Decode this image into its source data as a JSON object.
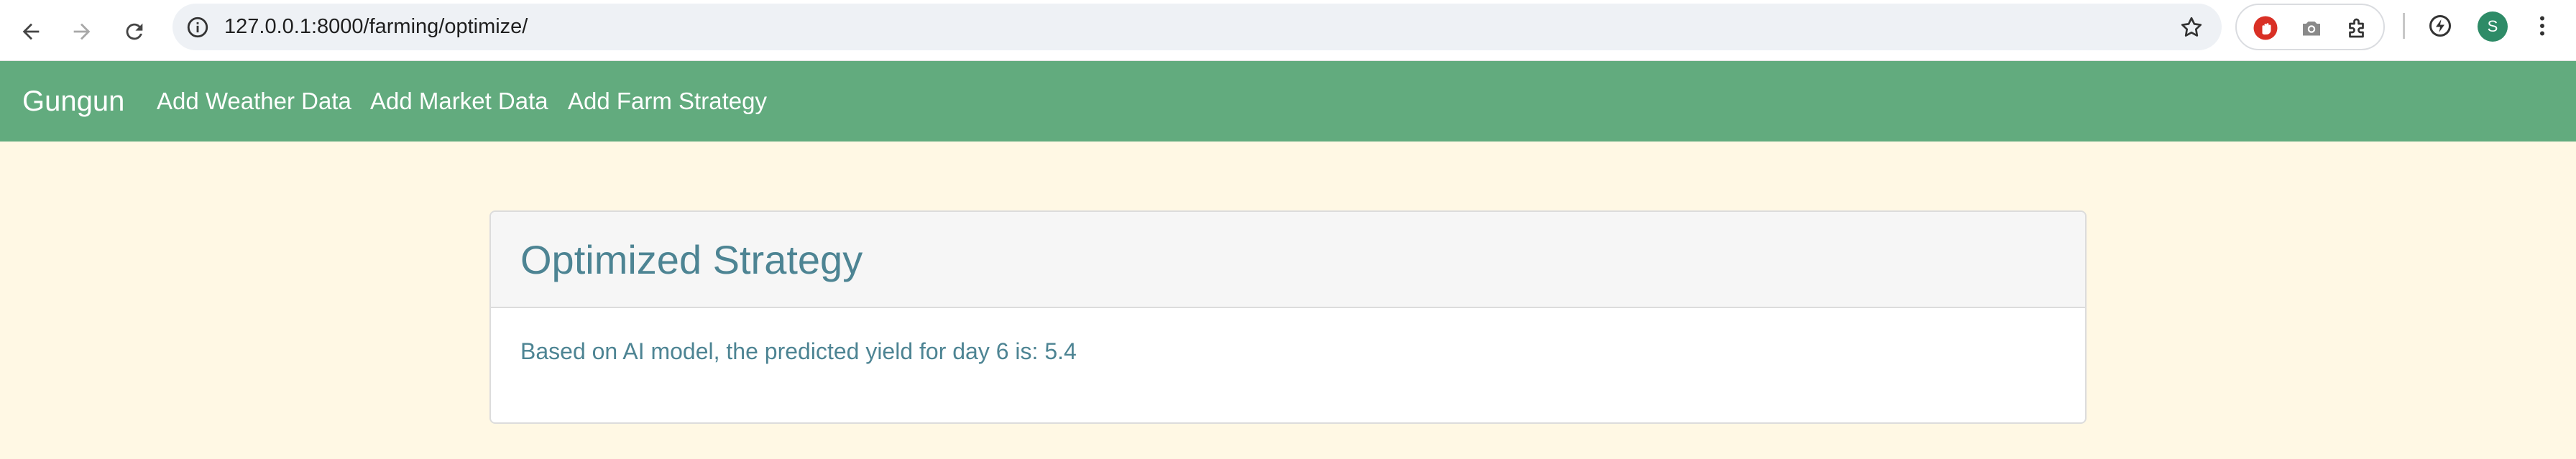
{
  "browser": {
    "url": "127.0.0.1:8000/farming/optimize/",
    "profile_initial": "S",
    "icons": {
      "back": "back-arrow-icon",
      "forward": "forward-arrow-icon",
      "reload": "reload-icon",
      "site_info": "site-info-icon",
      "bookmark": "star-icon",
      "extension_1": "stop-hand-icon",
      "extension_2": "camera-icon",
      "extensions_menu": "puzzle-icon",
      "performance": "performance-icon",
      "menu": "kebab-menu-icon"
    }
  },
  "navbar": {
    "brand": "Gungun",
    "links": [
      {
        "label": "Add Weather Data"
      },
      {
        "label": "Add Market Data"
      },
      {
        "label": "Add Farm Strategy"
      }
    ]
  },
  "card": {
    "title": "Optimized Strategy",
    "text": "Based on AI model, the predicted yield for day 6 is: 5.4"
  },
  "colors": {
    "navbar_bg": "#62ab7e",
    "page_bg": "#fff8e4",
    "card_text": "#4d8493",
    "avatar": "#2e8b67",
    "extension_red": "#d93025"
  }
}
